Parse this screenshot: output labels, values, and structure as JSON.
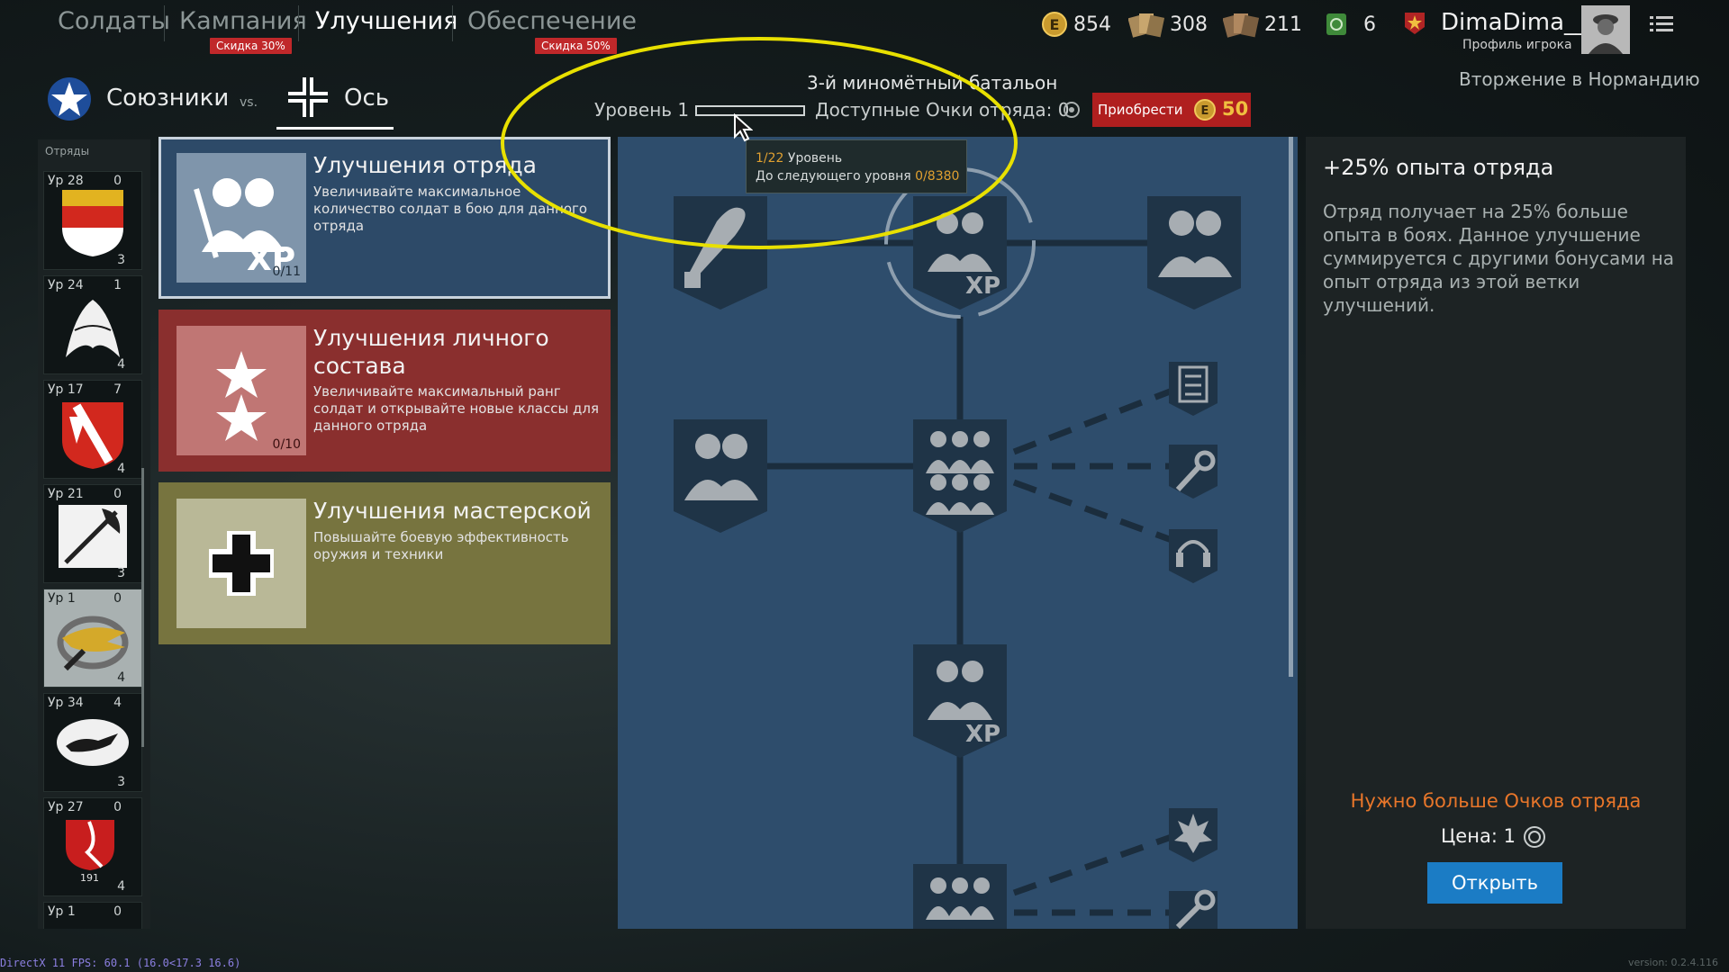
{
  "nav": {
    "tabs": [
      {
        "label": "Солдаты"
      },
      {
        "label": "Кампания",
        "discount": "Скидка 30%"
      },
      {
        "label": "Улучшения"
      },
      {
        "label": "Обеспечение",
        "discount": "Скидка 50%"
      }
    ],
    "active_tab": "Улучшения"
  },
  "resources": {
    "gold": "854",
    "cards_1": "308",
    "cards_2": "211",
    "tickets": "6"
  },
  "profile": {
    "name": "DimaDima__",
    "subtitle": "Профиль игрока"
  },
  "campaign": "Вторжение в Нормандию",
  "factions": {
    "allies": "Союзники",
    "vs": "vs.",
    "axis": "Ось"
  },
  "squad_header": {
    "name": "3-й миномётный батальон",
    "level_label": "Уровень 1",
    "level_progress": 0.0,
    "points_label": "Доступные Очки отряда: 0",
    "buy_label": "Приобрести",
    "buy_price": "50"
  },
  "tooltip": {
    "level_value": "1/22",
    "level_text": "Уровень",
    "next_text": "До следующего уровня",
    "next_value": "0/8380"
  },
  "squads_header": "Отряды",
  "squads": [
    {
      "lvl": "Ур 28",
      "pts": "0",
      "slots": "3"
    },
    {
      "lvl": "Ур 24",
      "pts": "1",
      "slots": "4"
    },
    {
      "lvl": "Ур 17",
      "pts": "7",
      "slots": "4"
    },
    {
      "lvl": "Ур 21",
      "pts": "0",
      "slots": "3"
    },
    {
      "lvl": "Ур 1",
      "pts": "0",
      "slots": "4"
    },
    {
      "lvl": "Ур 34",
      "pts": "4",
      "slots": "3"
    },
    {
      "lvl": "Ур 27",
      "pts": "0",
      "slots": "4"
    },
    {
      "lvl": "Ур 1",
      "pts": "0",
      "slots": ""
    }
  ],
  "squad_badge_number": "191",
  "categories": [
    {
      "title": "Улучшения отряда",
      "desc": "Увеличивайте максимальное количество солдат в бою для данного отряда",
      "count": "0/11",
      "color": "#2d4a68"
    },
    {
      "title": "Улучшения личного состава",
      "desc": "Увеличивайте максимальный ранг солдат и открывайте новые классы для данного отряда",
      "count": "0/10",
      "color": "#8a2f2e"
    },
    {
      "title": "Улучшения мастерской",
      "desc": "Повышайте боевую эффективность оружия и техники",
      "count": "",
      "color": "#77743f"
    }
  ],
  "tree_badge_text": "XP",
  "detail": {
    "title": "+25% опыта отряда",
    "desc": "Отряд получает на 25% больше опыта в боях. Данное улучшение суммируется с другими бонусами на опыт отряда из этой ветки улучшений.",
    "warning": "Нужно больше Очков отряда",
    "price_label": "Цена: 1",
    "open_button": "Открыть"
  },
  "footer": {
    "debug": "DirectX 11 FPS: 60.1 (16.0<17.3 16.6)",
    "version": "version: 0.2.4.116"
  },
  "colors": {
    "accent_red": "#c0282a",
    "open_button": "#1b7cc5",
    "warning": "#e8762a",
    "tree_bg": "#2e4d6c",
    "highlight_ellipse": "#e8e000"
  }
}
